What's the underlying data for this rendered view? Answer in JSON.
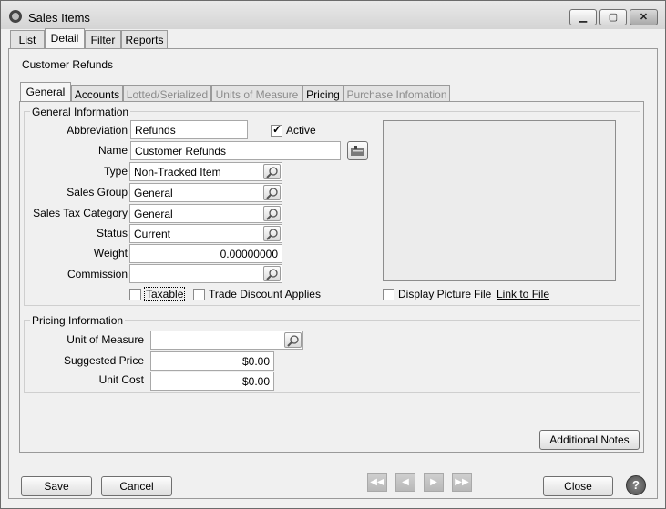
{
  "window": {
    "title": "Sales Items"
  },
  "main_tabs": [
    "List",
    "Detail",
    "Filter",
    "Reports"
  ],
  "record_title": "Customer Refunds",
  "sub_tabs": [
    "General",
    "Accounts",
    "Lotted/Serialized",
    "Units of Measure",
    "Pricing",
    "Purchase Infomation"
  ],
  "general": {
    "group_label": "General Information",
    "abbreviation_label": "Abbreviation",
    "abbreviation_value": "Refunds",
    "active_label": "Active",
    "name_label": "Name",
    "name_value": "Customer Refunds",
    "type_label": "Type",
    "type_value": "Non-Tracked Item",
    "sales_group_label": "Sales Group",
    "sales_group_value": "General",
    "tax_category_label": "Sales Tax Category",
    "tax_category_value": "General",
    "status_label": "Status",
    "status_value": "Current",
    "weight_label": "Weight",
    "weight_value": "0.00000000",
    "commission_label": "Commission",
    "commission_value": "",
    "taxable_label": "Taxable",
    "trade_discount_label": "Trade Discount Applies",
    "display_picture_label": "Display Picture",
    "file_label": "File",
    "link_label": "Link to File"
  },
  "pricing": {
    "group_label": "Pricing Information",
    "uom_label": "Unit of Measure",
    "uom_value": "",
    "suggested_price_label": "Suggested Price",
    "suggested_price_value": "$0.00",
    "unit_cost_label": "Unit Cost",
    "unit_cost_value": "$0.00"
  },
  "buttons": {
    "additional_notes": "Additional Notes",
    "save": "Save",
    "cancel": "Cancel",
    "close": "Close"
  }
}
